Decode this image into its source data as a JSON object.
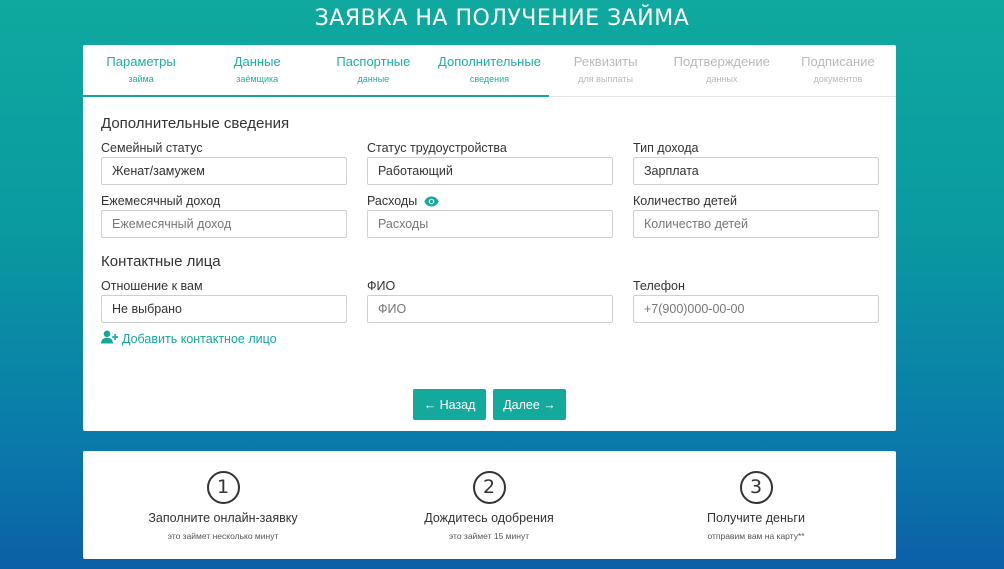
{
  "page": {
    "title": "ЗАЯВКА НА ПОЛУЧЕНИЕ ЗАЙМА"
  },
  "steps": [
    {
      "main": "Параметры",
      "sub": "займа",
      "state": "done"
    },
    {
      "main": "Данные",
      "sub": "заёмщика",
      "state": "done"
    },
    {
      "main": "Паспортные",
      "sub": "данные",
      "state": "done"
    },
    {
      "main": "Дополнительные",
      "sub": "сведения",
      "state": "active"
    },
    {
      "main": "Реквизиты",
      "sub": "для выплаты",
      "state": "inactive"
    },
    {
      "main": "Подтверждение",
      "sub": "данных",
      "state": "inactive"
    },
    {
      "main": "Подписание",
      "sub": "документов",
      "state": "inactive"
    }
  ],
  "additional": {
    "title": "Дополнительные сведения",
    "family_status": {
      "label": "Семейный статус",
      "value": "Женат/замужем"
    },
    "employment_status": {
      "label": "Статус трудоустройства",
      "value": "Работающий"
    },
    "income_type": {
      "label": "Тип дохода",
      "value": "Зарплата"
    },
    "monthly_income": {
      "label": "Ежемесячный доход",
      "placeholder": "Ежемесячный доход"
    },
    "expenses": {
      "label": "Расходы",
      "placeholder": "Расходы"
    },
    "children_count": {
      "label": "Количество детей",
      "placeholder": "Количество детей"
    }
  },
  "contacts": {
    "title": "Контактные лица",
    "relation": {
      "label": "Отношение к вам",
      "value": "Не выбрано"
    },
    "fio": {
      "label": "ФИО",
      "placeholder": "ФИО"
    },
    "phone": {
      "label": "Телефон",
      "placeholder": "+7(900)000-00-00"
    },
    "add_label": "Добавить контактное лицо"
  },
  "buttons": {
    "back": "← Назад",
    "next": "Далее →"
  },
  "info": [
    {
      "num": "1",
      "title": "Заполните онлайн-заявку",
      "sub": "это займет несколько минут"
    },
    {
      "num": "2",
      "title": "Дождитесь одобрения",
      "sub": "это займет 15 минут"
    },
    {
      "num": "3",
      "title": "Получите деньги",
      "sub": "отправим вам на карту**"
    }
  ],
  "colors": {
    "accent": "#13a99d",
    "inactive": "#b9b9b9"
  }
}
